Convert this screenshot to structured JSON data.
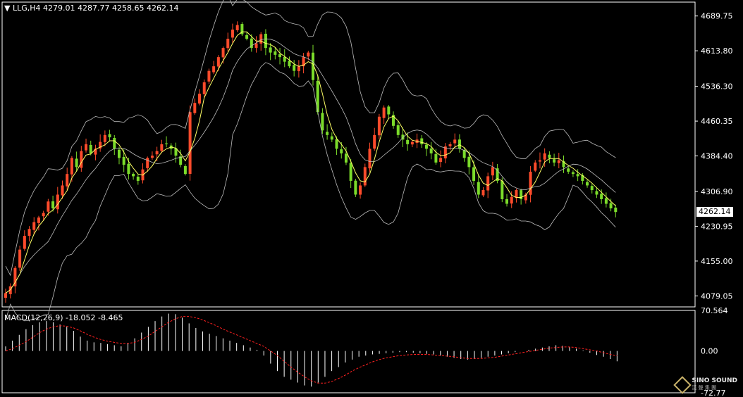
{
  "header": {
    "symbol_label": "LLG,H4",
    "open": "4279.01",
    "high": "4287.77",
    "low": "4258.65",
    "close": "4262.14"
  },
  "macd_header": {
    "label": "MACD(12,26,9)",
    "main": "-18.052",
    "signal": "-8.465"
  },
  "price_tag": "4262.14",
  "logo": {
    "title": "SINO SOUND",
    "subtitle": "漢 聲 集 團"
  },
  "colors": {
    "background": "#000000",
    "bull": "#ff4b2b",
    "bear": "#7bdc2a",
    "ma": "#ffff66",
    "bands": "#bdbdbd",
    "grid_frame": "#ffffff",
    "macd_hist": "#ffffff",
    "macd_signal": "#ff2020"
  },
  "chart_data": [
    {
      "type": "candlestick",
      "title": "LLG,H4",
      "ylim": [
        4055,
        4720
      ],
      "y_ticks": [
        "4689.75",
        "4613.80",
        "4536.30",
        "4460.35",
        "4384.40",
        "4306.90",
        "4230.95",
        "4155.00",
        "4079.05"
      ],
      "overlays": [
        "bollinger-upper",
        "bollinger-middle",
        "bollinger-lower",
        "moving-average"
      ],
      "last_price": 4262.14,
      "close_series": [
        4085,
        4100,
        4140,
        4180,
        4210,
        4225,
        4240,
        4250,
        4260,
        4285,
        4270,
        4300,
        4320,
        4345,
        4380,
        4360,
        4395,
        4410,
        4390,
        4400,
        4415,
        4430,
        4425,
        4400,
        4380,
        4365,
        4345,
        4340,
        4330,
        4355,
        4380,
        4385,
        4395,
        4410,
        4410,
        4400,
        4385,
        4365,
        4345,
        4480,
        4500,
        4520,
        4545,
        4570,
        4580,
        4600,
        4620,
        4640,
        4660,
        4670,
        4650,
        4640,
        4620,
        4630,
        4650,
        4620,
        4610,
        4605,
        4600,
        4590,
        4580,
        4570,
        4580,
        4600,
        4610,
        4550,
        4480,
        4440,
        4430,
        4420,
        4400,
        4390,
        4370,
        4330,
        4300,
        4320,
        4360,
        4400,
        4430,
        4470,
        4490,
        4475,
        4450,
        4430,
        4420,
        4410,
        4415,
        4420,
        4410,
        4400,
        4390,
        4370,
        4380,
        4405,
        4410,
        4420,
        4400,
        4380,
        4360,
        4330,
        4300,
        4310,
        4340,
        4360,
        4330,
        4290,
        4280,
        4295,
        4310,
        4290,
        4300,
        4350,
        4370,
        4375,
        4390,
        4380,
        4370,
        4375,
        4360,
        4350,
        4345,
        4340,
        4330,
        4320,
        4310,
        4300,
        4290,
        4280,
        4270,
        4262
      ]
    },
    {
      "type": "bar",
      "title": "MACD(12,26,9)",
      "ylim": [
        -72.77,
        70.564
      ],
      "y_ticks": [
        "70.564",
        "0.00",
        "-72.77"
      ],
      "series": [
        {
          "name": "MACD",
          "values": [
            8,
            18,
            28,
            38,
            45,
            50,
            52,
            50,
            46,
            42,
            35,
            25,
            18,
            15,
            14,
            12,
            10,
            8,
            14,
            22,
            32,
            42,
            52,
            60,
            65,
            64,
            58,
            48,
            40,
            34,
            30,
            26,
            22,
            18,
            14,
            10,
            6,
            2,
            -8,
            -22,
            -35,
            -45,
            -50,
            -55,
            -60,
            -62,
            -55,
            -45,
            -35,
            -28,
            -20,
            -15,
            -10,
            -8,
            -6,
            -5,
            -4,
            -3,
            -2,
            -2,
            -3,
            -4,
            -5,
            -6,
            -8,
            -10,
            -12,
            -14,
            -15,
            -14,
            -12,
            -10,
            -8,
            -6,
            -4,
            -2,
            0,
            2,
            4,
            6,
            8,
            10,
            9,
            7,
            4,
            1,
            -3,
            -7,
            -10,
            -14,
            -18
          ]
        },
        {
          "name": "Signal",
          "values": [
            0,
            4,
            10,
            16,
            24,
            32,
            38,
            42,
            44,
            43,
            40,
            35,
            29,
            24,
            20,
            17,
            15,
            13,
            13,
            15,
            20,
            26,
            34,
            42,
            50,
            56,
            60,
            60,
            58,
            54,
            49,
            44,
            38,
            33,
            28,
            23,
            18,
            13,
            8,
            0,
            -8,
            -18,
            -28,
            -37,
            -45,
            -52,
            -56,
            -56,
            -53,
            -48,
            -42,
            -35,
            -29,
            -24,
            -19,
            -15,
            -12,
            -10,
            -8,
            -7,
            -6,
            -6,
            -6,
            -7,
            -8,
            -9,
            -10,
            -12,
            -13,
            -13,
            -13,
            -12,
            -11,
            -9,
            -7,
            -5,
            -3,
            -1,
            1,
            3,
            5,
            6,
            7,
            7,
            6,
            4,
            2,
            0,
            -3,
            -6,
            -8.465
          ]
        }
      ]
    }
  ]
}
